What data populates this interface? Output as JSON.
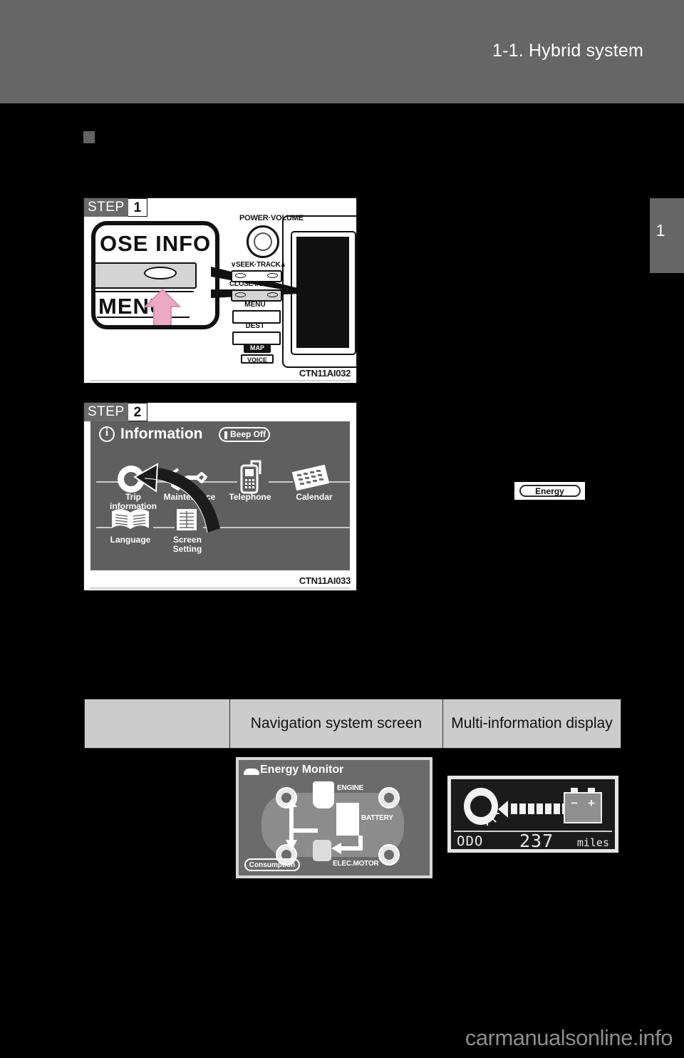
{
  "header": {
    "title": "1-1. Hybrid system",
    "chapter_tab_number": "1"
  },
  "figures": {
    "step1": {
      "step_word": "STEP",
      "step_number": "1",
      "code": "CTN11AI032",
      "callout_text_top": "OSE  INFO",
      "callout_text_bottom": "MENU",
      "panel_labels": {
        "power_volume": "POWER·VOLUME",
        "seek_track": "∨SEEK·TRACK∧",
        "close_info": "CLOSE  INFO",
        "menu": "MENU",
        "dest": "DEST",
        "map": "MAP",
        "voice": "VOICE"
      }
    },
    "step2": {
      "step_word": "STEP",
      "step_number": "2",
      "code": "CTN11AI033",
      "screen_title": "Information",
      "beep_button": "Beep Off",
      "menu_items": [
        {
          "label": "Trip\ninformation",
          "icon": "tire-icon"
        },
        {
          "label": "Maintenance",
          "icon": "wrench-icon"
        },
        {
          "label": "Telephone",
          "icon": "phone-icon"
        },
        {
          "label": "Calendar",
          "icon": "calendar-icon"
        },
        {
          "label": "Language",
          "icon": "book-icon"
        },
        {
          "label": "Screen\nSetting",
          "icon": "screen-setting-icon"
        }
      ]
    }
  },
  "energy_button": {
    "label": "Energy"
  },
  "comparison_table": {
    "headers": [
      "",
      "Navigation system screen",
      "Multi-information display"
    ]
  },
  "energy_monitor": {
    "title": "Energy Monitor",
    "labels": {
      "engine": "ENGINE",
      "battery": "BATTERY",
      "electric_motor": "ELEC.MOTOR"
    },
    "button": "Consumption"
  },
  "multi_information_display": {
    "odo_label": "ODO",
    "odo_value": "237",
    "odo_unit": "miles",
    "flow_bars": 9,
    "flow_direction": "battery-to-wheel"
  },
  "watermark": "carmanualsonline.info",
  "colors": {
    "page_background": "#000000",
    "header_band": "#666666",
    "table_header": "#cccccc",
    "nav_screen": "#5f5f5f",
    "energy_screen": "#6b6b6b",
    "mid_screen": "#1b1b1b",
    "arrow_pink": "#eda8c2"
  }
}
